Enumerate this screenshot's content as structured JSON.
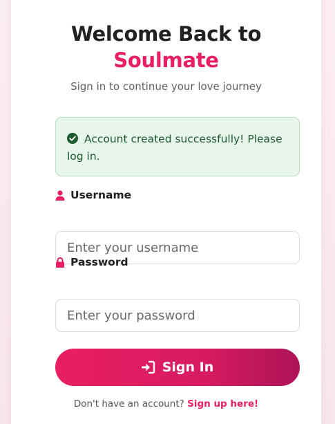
{
  "header": {
    "title_line1": "Welcome Back to",
    "title_brand": "Soulmate",
    "subtitle": "Sign in to continue your love journey",
    "logo_icon": "heart-arrow-icon"
  },
  "alert": {
    "icon": "check-circle-icon",
    "message": "Account created successfully! Please log in."
  },
  "form": {
    "username": {
      "label": "Username",
      "icon": "user-icon",
      "placeholder": "Enter your username",
      "value": ""
    },
    "password": {
      "label": "Password",
      "icon": "lock-icon",
      "placeholder": "Enter your password",
      "value": ""
    },
    "submit": {
      "label": "Sign In",
      "icon": "sign-in-icon"
    }
  },
  "footer": {
    "prompt": "Don't have an account?",
    "link_label": "Sign up here!"
  },
  "colors": {
    "brand": "#e91e63",
    "brand_dark": "#ad1457",
    "success_bg": "#e8f5ea",
    "success_text": "#1c5b2c"
  }
}
